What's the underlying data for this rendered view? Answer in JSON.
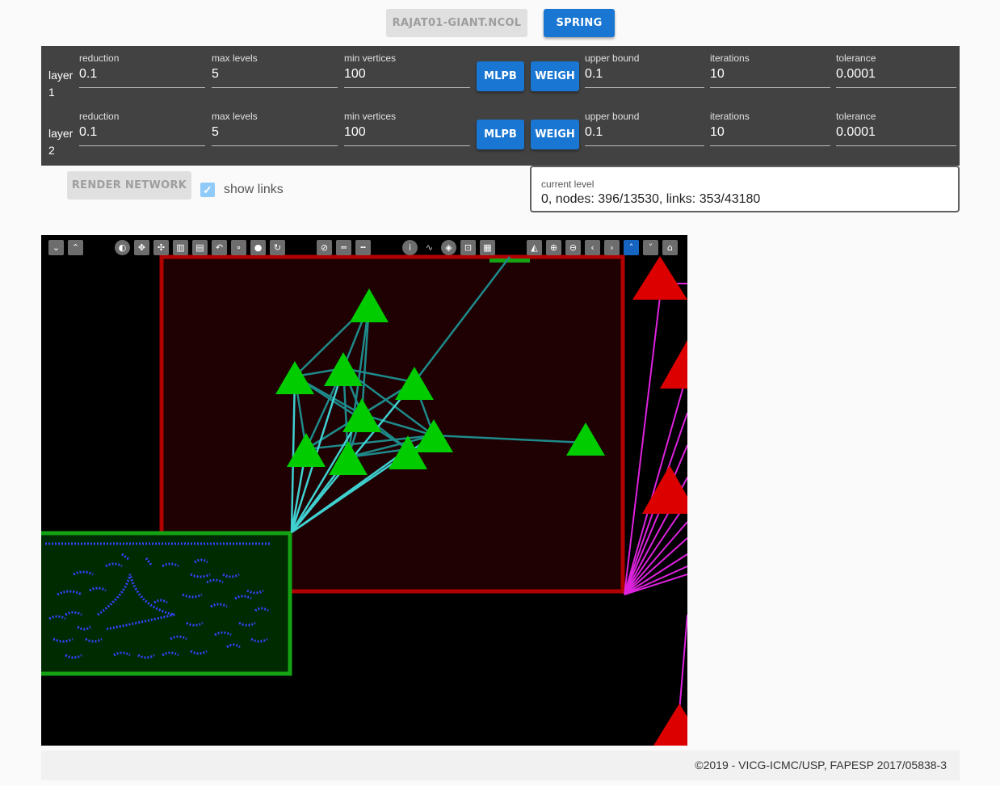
{
  "header": {
    "file_button": "RAJAT01-GIANT.NCOL",
    "spring_button": "SPRING"
  },
  "layers": [
    {
      "label": "layer 1",
      "reduction_label": "reduction",
      "reduction": "0.1",
      "max_levels_label": "max levels",
      "max_levels": "5",
      "min_vertices_label": "min vertices",
      "min_vertices": "100",
      "mlpb_button": "MLPB",
      "weigh_button": "WEIGH",
      "upper_bound_label": "upper bound",
      "upper_bound": "0.1",
      "iterations_label": "iterations",
      "iterations": "10",
      "tolerance_label": "tolerance",
      "tolerance": "0.0001"
    },
    {
      "label": "layer 2",
      "reduction_label": "reduction",
      "reduction": "0.1",
      "max_levels_label": "max levels",
      "max_levels": "5",
      "min_vertices_label": "min vertices",
      "min_vertices": "100",
      "mlpb_button": "MLPB",
      "weigh_button": "WEIGH",
      "upper_bound_label": "upper bound",
      "upper_bound": "0.1",
      "iterations_label": "iterations",
      "iterations": "10",
      "tolerance_label": "tolerance",
      "tolerance": "0.0001"
    }
  ],
  "controls": {
    "render_button": "RENDER NETWORK",
    "show_links_label": "show links",
    "show_links_checked": true
  },
  "level": {
    "label": "current level",
    "value": "0, nodes: 396/13530, links: 353/43180"
  },
  "toolbar_icons": [
    "collapse-icon",
    "expand-icon",
    "contrast-icon",
    "move-icon",
    "cluster-icon",
    "bar-chart-icon",
    "bar-chart-alt-icon",
    "undo-icon",
    "node-small-icon",
    "node-large-icon",
    "rotate-icon",
    "hide-nodes-icon",
    "edge-thin-icon",
    "edge-dashed-icon",
    "info-icon",
    "path-icon",
    "compass-icon",
    "select-icon",
    "region-select-icon",
    "fill-icon",
    "zoom-in-icon",
    "zoom-out-icon",
    "pan-left-icon",
    "pan-right-icon",
    "pan-up-icon",
    "pan-down-icon",
    "home-icon"
  ],
  "colors": {
    "accent": "#1976d2",
    "panel": "#424242",
    "node_green": "#00cc00",
    "node_red": "#dd0000",
    "edge_cyan": "#33cccc",
    "edge_magenta": "#dd22dd",
    "node_blue": "#2233ff"
  },
  "footer": {
    "text": "©2019 - VICG-ICMC/USP, FAPESP 2017/05838-3"
  }
}
